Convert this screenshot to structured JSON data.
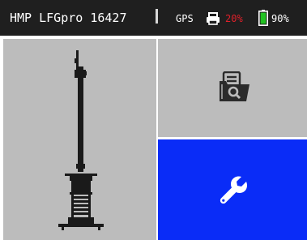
{
  "status_bar": {
    "device_title": "HMP LFGpro 16427",
    "gps_label": "GPS",
    "printer_icon": "printer-icon",
    "printer_value": "20%",
    "battery_icon": "battery-icon",
    "battery_value": "90%"
  },
  "tiles": {
    "device": {
      "icon": "drop-weight-device-icon"
    },
    "reports": {
      "icon": "document-search-icon"
    },
    "settings": {
      "icon": "wrench-icon"
    }
  },
  "colors": {
    "status_bar_bg": "#1f1f1f",
    "tile_gray": "#bcbcbc",
    "settings_blue": "#0a2cf7",
    "printer_warning": "#e0202a",
    "battery_green": "#22c322"
  }
}
